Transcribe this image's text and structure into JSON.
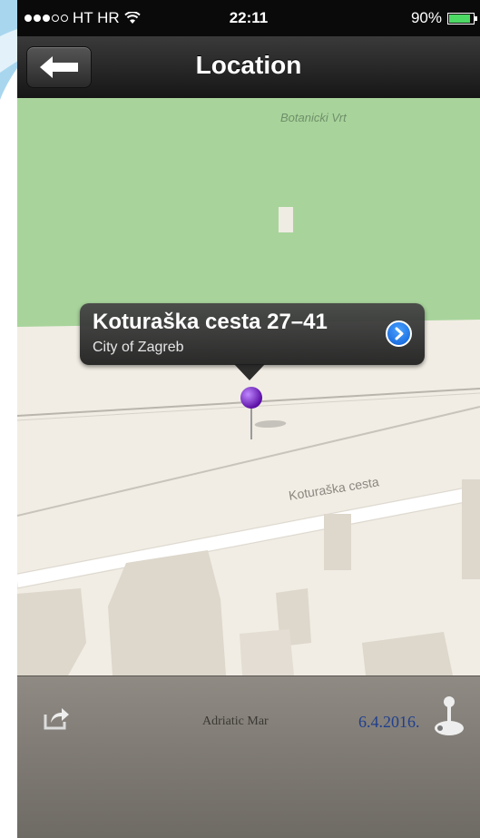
{
  "statusbar": {
    "carrier": "HT HR",
    "time": "22:11",
    "battery": "90%",
    "battery_level": 0.9
  },
  "navbar": {
    "title": "Location",
    "back_icon": "back-arrow-icon"
  },
  "map": {
    "poi": "Botanicki Vrt",
    "road": "Koturaška cesta",
    "colors": {
      "park": "#a8d49b",
      "land": "#f1ede4",
      "building": "#ddd7cc",
      "road": "#ffffff"
    }
  },
  "callout": {
    "title": "Koturaška cesta 27–41",
    "subtitle": "City of Zagreb",
    "disclosure_icon": "chevron-right-icon"
  },
  "toolbar": {
    "share_icon": "share-icon",
    "label": "Adriatic Mar",
    "date": "6.4.2016.",
    "action_icon": "joystick-icon"
  }
}
